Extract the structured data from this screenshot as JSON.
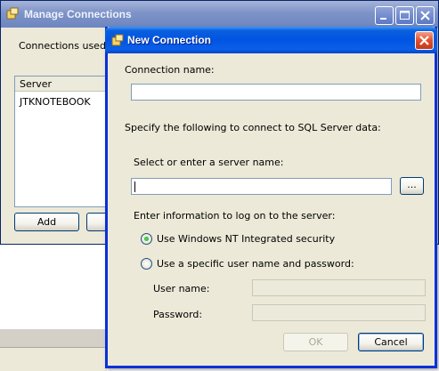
{
  "background_window": {
    "title": "Manage Connections",
    "label": "Connections used in",
    "list_header": "Server",
    "list_rows": [
      "JTKNOTEBOOK"
    ],
    "add_label": "Add"
  },
  "dialog": {
    "title": "New Connection",
    "connection_name_label": "Connection name:",
    "connection_name_value": "",
    "instructions": "Specify the following to connect to SQL Server data:",
    "server_label": "Select or enter a server name:",
    "server_value": "",
    "browse_label": "...",
    "logon_label": "Enter information to log on to the server:",
    "radio_nt_label": "Use Windows NT Integrated security",
    "radio_nt_selected": true,
    "radio_specific_label": "Use a specific user name and password:",
    "radio_specific_selected": false,
    "username_label": "User name:",
    "password_label": "Password:",
    "ok_label": "OK",
    "cancel_label": "Cancel"
  },
  "colors": {
    "dialog_title_bar": "#0054e3",
    "inactive_title_bar": "#7d93c8",
    "window_face": "#ece9d8"
  }
}
